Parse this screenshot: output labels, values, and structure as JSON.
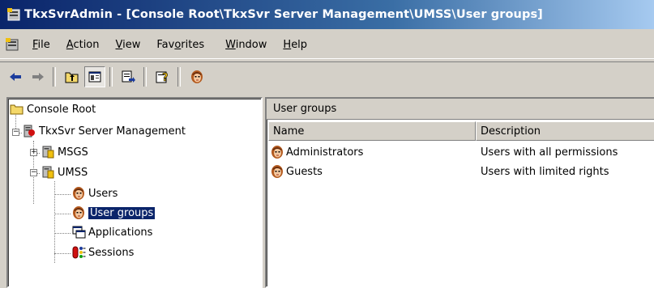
{
  "window": {
    "title": "TkxSvrAdmin - [Console Root\\TkxSvr Server Management\\UMSS\\User groups]"
  },
  "menu": [
    {
      "label": "File",
      "key": "F",
      "rest": "ile"
    },
    {
      "label": "Action",
      "key": "A",
      "rest": "ction"
    },
    {
      "label": "View",
      "key": "V",
      "rest": "iew"
    },
    {
      "label": "Favorites",
      "pre": "Fav",
      "key": "o",
      "rest": "rites"
    },
    {
      "label": "Window",
      "key": "W",
      "rest": "indow"
    },
    {
      "label": "Help",
      "key": "H",
      "rest": "elp"
    }
  ],
  "toolbar": {
    "buttons": [
      "back-arrow-icon",
      "forward-arrow-icon",
      "up-one-level-icon",
      "show-hide-console-tree-icon",
      "export-list-icon",
      "help-icon",
      "umss-icon"
    ]
  },
  "tree": {
    "root": "Console Root",
    "server": "TkxSvr Server Management",
    "msgs": "MSGS",
    "umss": "UMSS",
    "users": "Users",
    "user_groups": "User groups",
    "applications": "Applications",
    "sessions": "Sessions"
  },
  "right": {
    "header": "User groups",
    "columns": [
      "Name",
      "Description"
    ],
    "rows": [
      {
        "name": "Administrators",
        "description": "Users with all permissions"
      },
      {
        "name": "Guests",
        "description": "Users with limited rights"
      }
    ]
  }
}
